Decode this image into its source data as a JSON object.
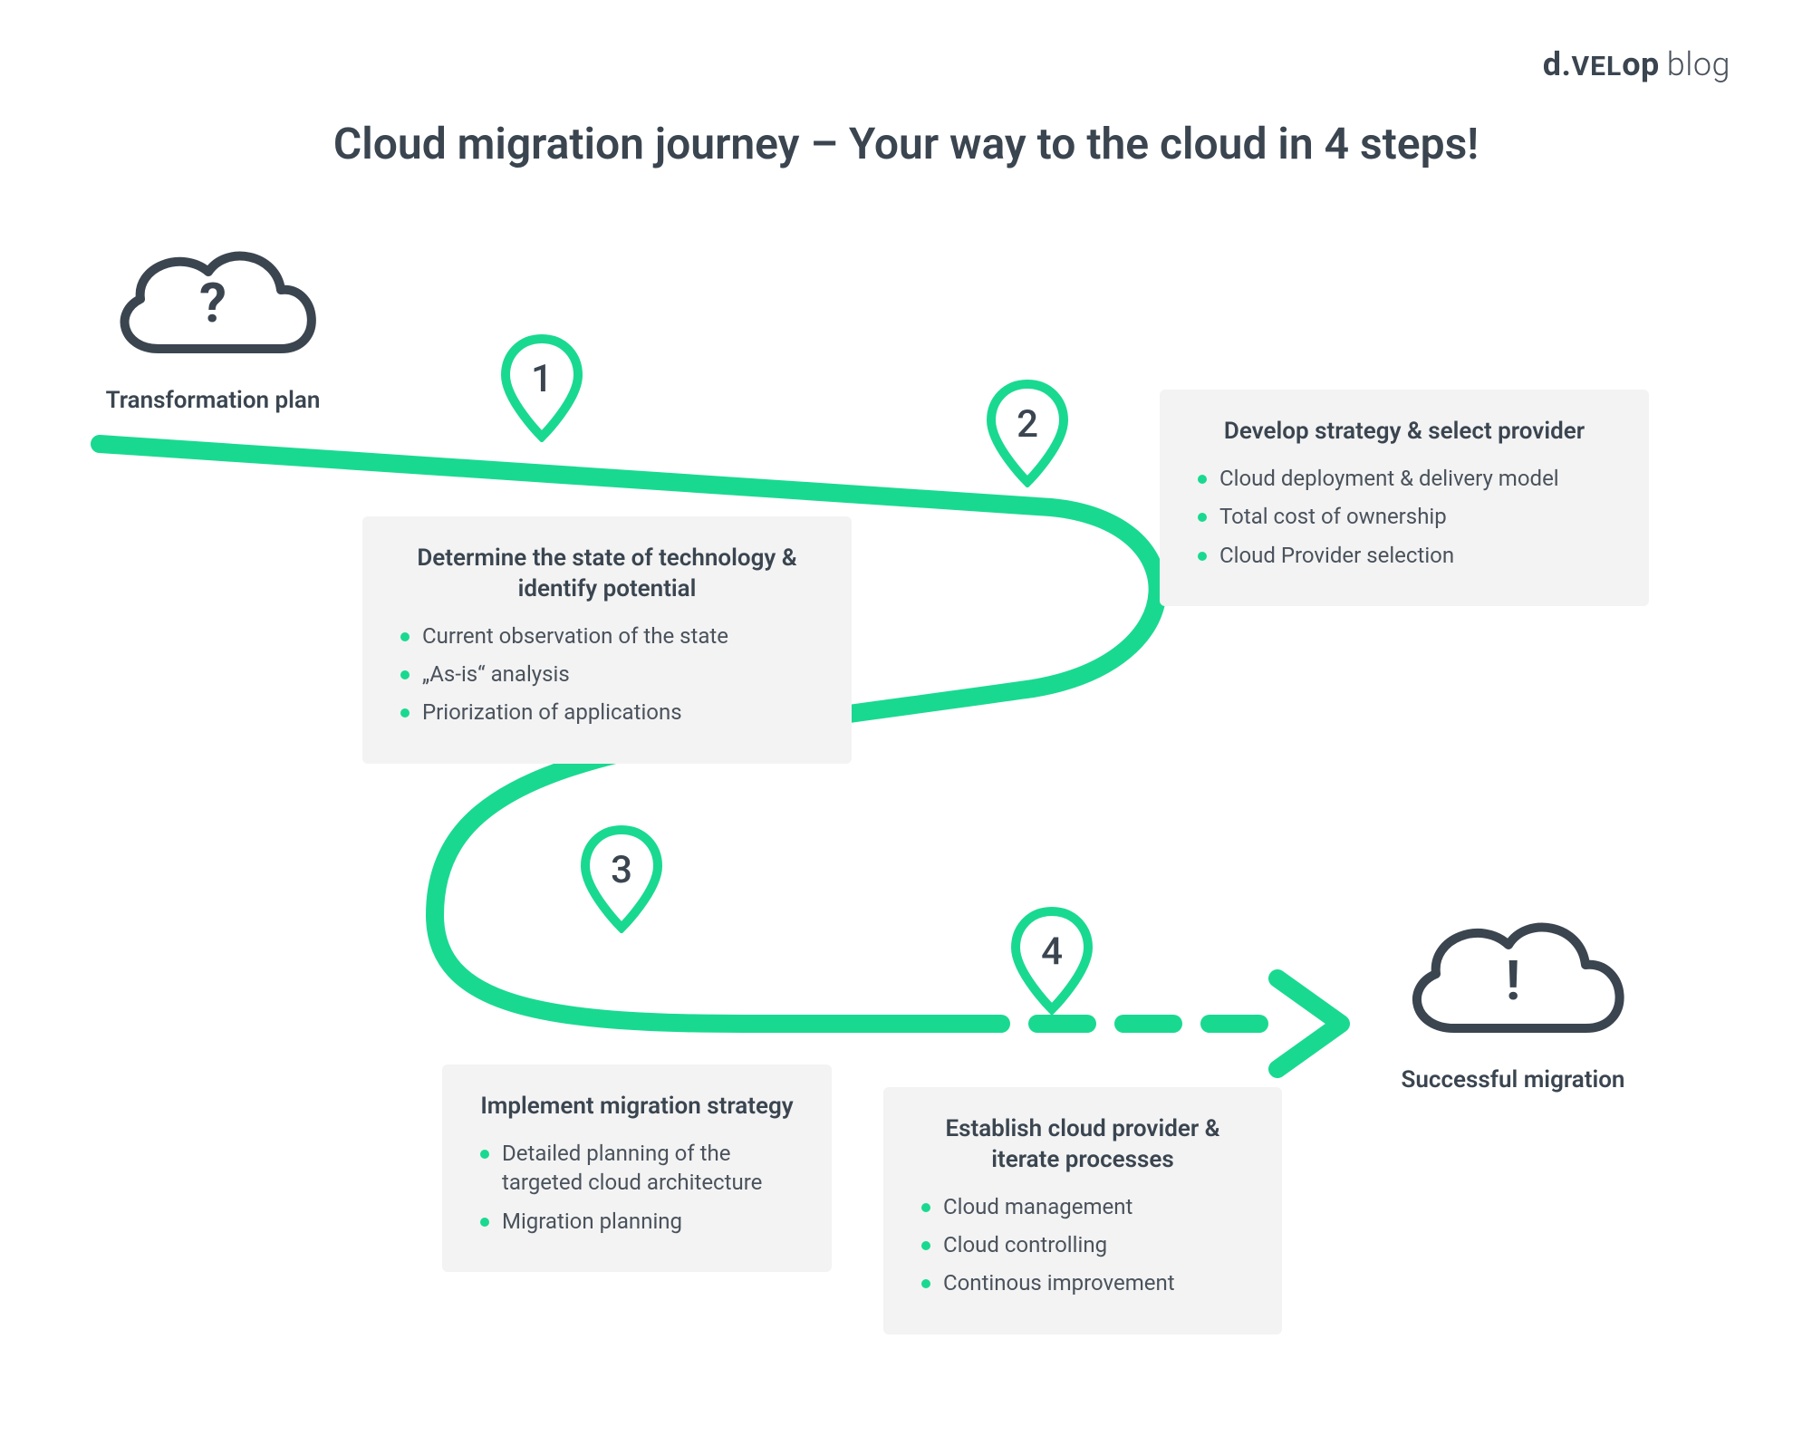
{
  "brand": {
    "prefix": "d.",
    "mid": "ve",
    "midUpper": "L",
    "suffix": "op",
    "tag": "blog"
  },
  "title": "Cloud migration journey – Your way to the cloud in 4 steps!",
  "start": {
    "label": "Transformation plan",
    "symbol": "?"
  },
  "end": {
    "label": "Successful migration",
    "symbol": "!"
  },
  "pins": {
    "p1": "1",
    "p2": "2",
    "p3": "3",
    "p4": "4"
  },
  "steps": {
    "s1": {
      "title": "Determine the state of technology & identify potential",
      "items": [
        "Current observation of the state",
        "„As-is“ analysis",
        "Priorization of applications"
      ]
    },
    "s2": {
      "title": "Develop strategy & select provider",
      "items": [
        "Cloud deployment & delivery model",
        "Total cost of ownership",
        "Cloud Provider selection"
      ]
    },
    "s3": {
      "title": "Implement migration strategy",
      "items": [
        "Detailed planning of the targeted cloud architecture",
        "Migration planning"
      ]
    },
    "s4": {
      "title": "Establish cloud provider & iterate processes",
      "items": [
        "Cloud management",
        "Cloud controlling",
        "Continous improvement"
      ]
    }
  },
  "colors": {
    "accent": "#19d990",
    "dark": "#3a4550",
    "boxbg": "#f3f3f3"
  }
}
